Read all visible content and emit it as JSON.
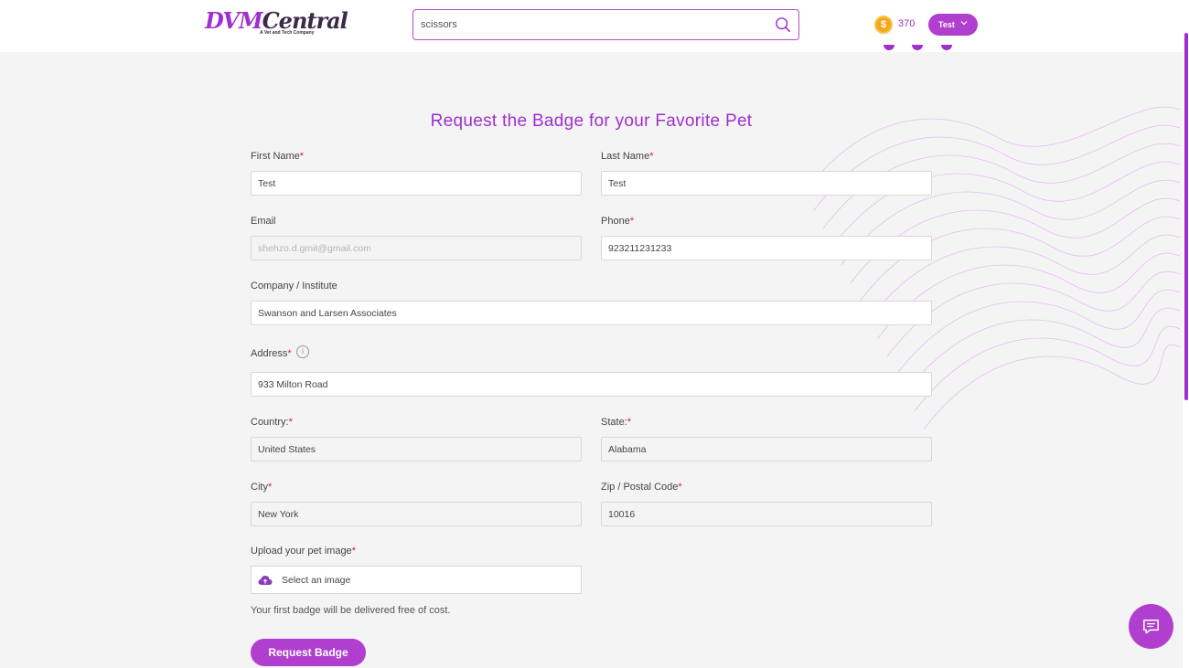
{
  "header": {
    "logo_main_a": "DVM",
    "logo_main_b": "Central",
    "logo_tagline": "A Vet and Tech Company",
    "search_value": "scissors",
    "search_icon": "search-icon",
    "coins": "370",
    "user_label": "Test",
    "user_chevron": "chevron-down-icon",
    "accent_color": "#a02fcf"
  },
  "form": {
    "title": "Request the Badge for your Favorite Pet",
    "required_marker": "*",
    "first_name": {
      "label": "First Name",
      "value": "Test"
    },
    "last_name": {
      "label": "Last Name",
      "value": "Test"
    },
    "email": {
      "label": "Email",
      "value": "shehzo.d.gmit@gmail.com"
    },
    "phone": {
      "label": "Phone",
      "value": "923211231233"
    },
    "company": {
      "label": "Company / Institute",
      "value": "Swanson and Larsen Associates"
    },
    "address": {
      "label": "Address",
      "value": "933 Milton Road",
      "info_icon": "info-icon"
    },
    "country": {
      "label": "Country:",
      "value": "United States"
    },
    "state": {
      "label": "State:",
      "value": "Alabama"
    },
    "city": {
      "label": "City",
      "value": "New York"
    },
    "zip": {
      "label": "Zip / Postal Code",
      "value": "10016"
    },
    "upload": {
      "label": "Upload your pet image",
      "placeholder": "Select an image",
      "icon": "cloud-upload-icon"
    },
    "note": "Your first badge will be delivered free of cost.",
    "submit_label": "Request Badge"
  },
  "chat": {
    "icon": "chat-bubble-icon"
  }
}
